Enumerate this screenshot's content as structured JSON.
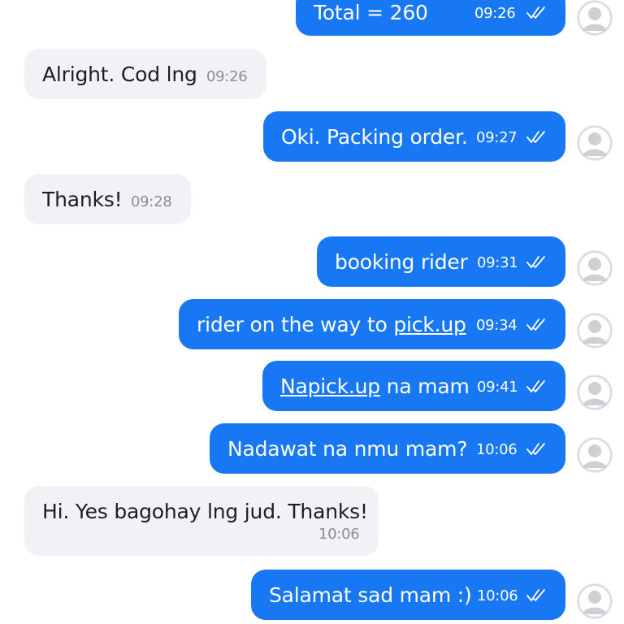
{
  "messages": [
    {
      "text": "Total = 260",
      "time": "09:26"
    },
    {
      "text": "Alright. Cod lng",
      "time": "09:26"
    },
    {
      "text": "Oki. Packing order.",
      "time": "09:27"
    },
    {
      "text": "Thanks!",
      "time": "09:28"
    },
    {
      "text": "booking rider",
      "time": "09:31"
    },
    {
      "text_prefix": "rider on the way to ",
      "link": "pick.up",
      "time": "09:34"
    },
    {
      "link": "Napick.up",
      "text_suffix": " na mam",
      "time": "09:41"
    },
    {
      "text": "Nadawat na nmu mam?",
      "time": "10:06"
    },
    {
      "text": "Hi. Yes bagohay lng jud. Thanks!",
      "time": "10:06"
    },
    {
      "text": "Salamat sad mam :)",
      "time": "10:06"
    }
  ],
  "colors": {
    "outgoing_bubble": "#1877f2",
    "incoming_bubble": "#f1f2f5",
    "incoming_time": "#8a8d91"
  },
  "icons": {
    "seen": "double-check-icon",
    "avatar": "default-avatar-icon"
  }
}
